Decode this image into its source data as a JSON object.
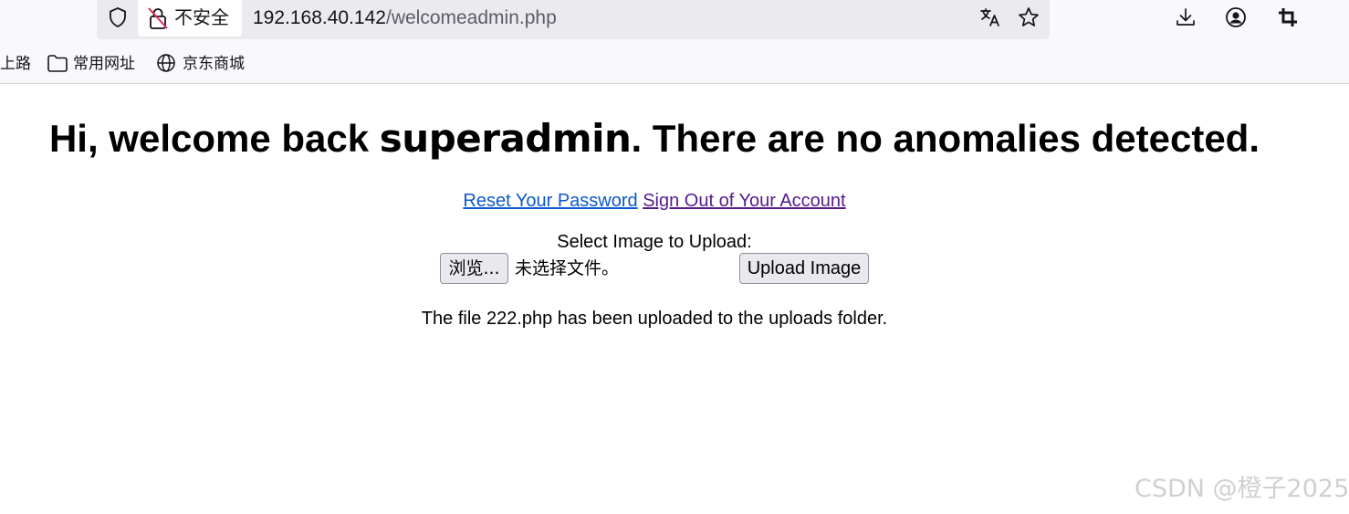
{
  "browser": {
    "security_label": "不安全",
    "url_host": "192.168.40.142",
    "url_path": "/welcomeadmin.php",
    "icons": [
      "shield-icon",
      "insecure-lock-icon",
      "translate-icon",
      "star-icon",
      "download-icon",
      "account-icon",
      "crop-icon"
    ]
  },
  "bookmarks": {
    "items": [
      {
        "label": "上路",
        "icon": "none"
      },
      {
        "label": "常用网址",
        "icon": "folder-icon"
      },
      {
        "label": "京东商城",
        "icon": "globe-icon"
      }
    ]
  },
  "page": {
    "heading_before": "Hi, welcome back ",
    "username": "superadmin",
    "heading_after": ". There are no anomalies detected.",
    "reset_link": "Reset Your Password",
    "signout_link": "Sign Out of Your Account",
    "upload_label": "Select Image to Upload:",
    "browse_button": "浏览...",
    "no_file_text": "未选择文件。",
    "upload_button": "Upload Image",
    "status_message": "The file 222.php has been uploaded to the uploads folder."
  },
  "watermark": "CSDN @橙子2025",
  "colors": {
    "link": "#0b57d0",
    "visited_link": "#551a8b",
    "chrome_bg": "#f9f9fb",
    "urlbar_bg": "#ebebef"
  }
}
